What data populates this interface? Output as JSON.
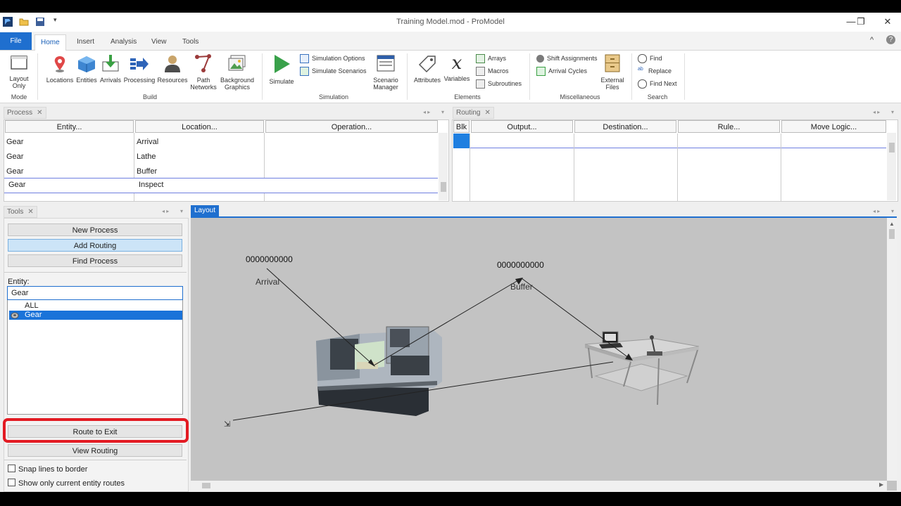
{
  "window": {
    "title": "Training Model.mod - ProModel",
    "minimize": "—",
    "restore": "❐",
    "close": "✕"
  },
  "ribbon": {
    "tabs": [
      {
        "label": "File"
      },
      {
        "label": "Home"
      },
      {
        "label": "Insert"
      },
      {
        "label": "Analysis"
      },
      {
        "label": "View"
      },
      {
        "label": "Tools"
      }
    ],
    "collapse": "^",
    "help": "?",
    "mode": {
      "layout_only": "Layout Only",
      "group": "Mode"
    },
    "build": {
      "locations": "Locations",
      "entities": "Entities",
      "arrivals": "Arrivals",
      "processing": "Processing",
      "resources": "Resources",
      "path_networks": "Path Networks",
      "background_graphics": "Background Graphics",
      "group": "Build"
    },
    "simulation": {
      "simulate": "Simulate",
      "simulation_options": "Simulation Options",
      "simulate_scenarios": "Simulate Scenarios",
      "scenario_manager": "Scenario Manager",
      "group": "Simulation"
    },
    "elements": {
      "attributes": "Attributes",
      "variables": "Variables",
      "arrays": "Arrays",
      "macros": "Macros",
      "subroutines": "Subroutines",
      "group": "Elements"
    },
    "misc": {
      "shift_assignments": "Shift Assignments",
      "arrival_cycles": "Arrival Cycles",
      "external_files": "External Files",
      "group": "Miscellaneous"
    },
    "search": {
      "find": "Find",
      "replace": "Replace",
      "find_next": "Find Next",
      "group": "Search"
    }
  },
  "process_pane": {
    "tab": "Process",
    "columns": [
      "Entity...",
      "Location...",
      "Operation..."
    ],
    "rows": [
      {
        "entity": "Gear",
        "location": "Arrival",
        "operation": ""
      },
      {
        "entity": "Gear",
        "location": "Lathe",
        "operation": ""
      },
      {
        "entity": "Gear",
        "location": "Buffer",
        "operation": ""
      },
      {
        "entity": "Gear",
        "location": "Inspect",
        "operation": ""
      }
    ]
  },
  "routing_pane": {
    "tab": "Routing",
    "columns": [
      "Blk",
      "Output...",
      "Destination...",
      "Rule...",
      "Move Logic..."
    ]
  },
  "tools_pane": {
    "tab": "Tools",
    "new_process": "New Process",
    "add_routing": "Add Routing",
    "find_process": "Find Process",
    "entity_label": "Entity:",
    "entity_value": "Gear",
    "entity_list": [
      "ALL",
      "Gear"
    ],
    "route_to_exit": "Route to Exit",
    "view_routing": "View Routing",
    "snap_lines": "Snap lines to border",
    "show_only_current": "Show only current entity routes"
  },
  "layout_pane": {
    "tab": "Layout",
    "arrival_label": "Arrival",
    "arrival_counter": "0000000000",
    "buffer_label": "Buffer",
    "buffer_counter": "0000000000"
  },
  "colors": {
    "accent": "#1f6fcf",
    "highlight": "#e31b23",
    "layout_bg": "#c3c3c3"
  }
}
